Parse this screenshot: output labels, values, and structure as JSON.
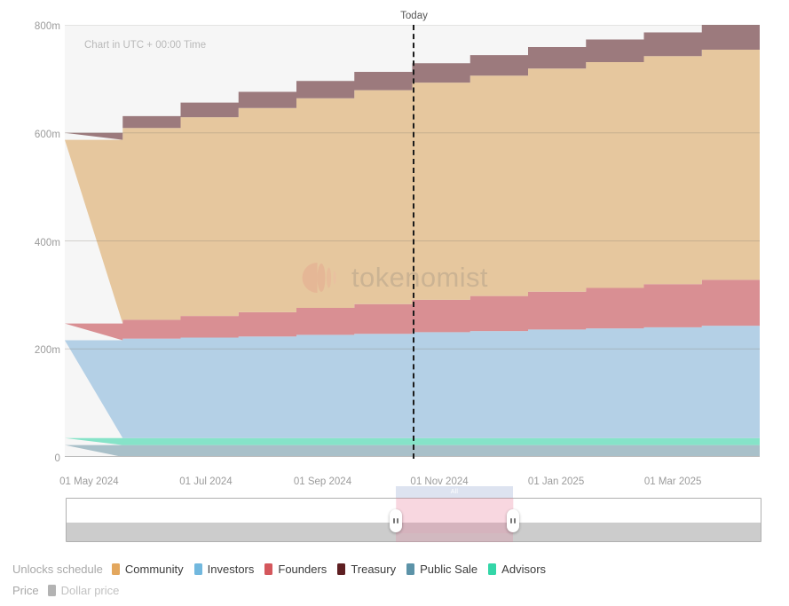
{
  "header": {
    "utc_note": "Chart in UTC + 00:00 Time",
    "today_label": "Today",
    "watermark": "tokenomist"
  },
  "legend": {
    "title": "Unlocks schedule",
    "price_title": "Price",
    "items": [
      {
        "label": "Community",
        "color": "#e3a75e"
      },
      {
        "label": "Investors",
        "color": "#72b8de"
      },
      {
        "label": "Founders",
        "color": "#d4575c"
      },
      {
        "label": "Treasury",
        "color": "#5e1f22"
      },
      {
        "label": "Public Sale",
        "color": "#5c93a8"
      },
      {
        "label": "Advisors",
        "color": "#34d6a8"
      }
    ],
    "price_items": [
      {
        "label": "Dollar price",
        "color": "#b3b3b3"
      }
    ]
  },
  "navigator": {
    "tooltip": "All",
    "left_handle": "range-start-handle",
    "right_handle": "range-end-handle"
  },
  "chart_data": {
    "type": "area",
    "stack": "stacked-step",
    "title": "Unlocks schedule",
    "xlabel": "",
    "ylabel": "",
    "ylim": [
      0,
      800000000
    ],
    "yticks": [
      0,
      200000000,
      400000000,
      600000000,
      800000000
    ],
    "ytick_labels": [
      "0",
      "200m",
      "400m",
      "600m",
      "800m"
    ],
    "xticks": [
      "01 May 2024",
      "01 Jul 2024",
      "01 Sep 2024",
      "01 Nov 2024",
      "01 Jan 2025",
      "01 Mar 2025"
    ],
    "xtick_positions": [
      0.035,
      0.203,
      0.371,
      0.539,
      0.707,
      0.875
    ],
    "grid": true,
    "today_position": 0.5,
    "x": [
      "2024-04-01",
      "2024-05-01",
      "2024-06-01",
      "2024-07-01",
      "2024-08-01",
      "2024-09-01",
      "2024-10-01",
      "2024-11-01",
      "2024-12-01",
      "2025-01-01",
      "2025-02-01",
      "2025-03-01",
      "2025-04-01"
    ],
    "series": [
      {
        "name": "Public Sale",
        "color": "#a9c0c9",
        "values": [
          22000000,
          22000000,
          22000000,
          22000000,
          22000000,
          22000000,
          22000000,
          22000000,
          22000000,
          22000000,
          22000000,
          22000000,
          22000000
        ]
      },
      {
        "name": "Advisors",
        "color": "#86e3c8",
        "values": [
          13000000,
          13000000,
          13000000,
          13000000,
          13000000,
          13000000,
          13000000,
          13000000,
          13000000,
          13000000,
          13000000,
          13000000,
          13000000
        ]
      },
      {
        "name": "Investors",
        "color": "#b4d0e6",
        "values": [
          181000000,
          184000000,
          186000000,
          188000000,
          191000000,
          193000000,
          196000000,
          198000000,
          201000000,
          203000000,
          205000000,
          208000000,
          210000000
        ]
      },
      {
        "name": "Founders",
        "color": "#d98f93",
        "values": [
          31000000,
          35000000,
          40000000,
          45000000,
          50000000,
          55000000,
          60000000,
          65000000,
          70000000,
          75000000,
          80000000,
          85000000,
          90000000
        ]
      },
      {
        "name": "Community",
        "color": "#e6c79e",
        "values": [
          340000000,
          355000000,
          368000000,
          378000000,
          388000000,
          396000000,
          402000000,
          408000000,
          413000000,
          418000000,
          422000000,
          426000000,
          429000000
        ]
      },
      {
        "name": "Treasury",
        "color": "#9c7a7d",
        "values": [
          13000000,
          22000000,
          27000000,
          30000000,
          32000000,
          34000000,
          36000000,
          38000000,
          40000000,
          42000000,
          44000000,
          46000000,
          48000000
        ]
      }
    ],
    "totals": [
      600000000,
      631000000,
      656000000,
      676000000,
      696000000,
      713000000,
      729000000,
      744000000,
      759000000,
      773000000,
      786000000,
      800000000,
      812000000
    ]
  }
}
